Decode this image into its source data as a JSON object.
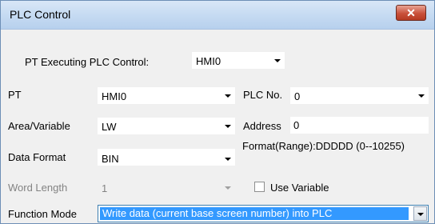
{
  "window": {
    "title": "PLC Control",
    "close_glyph": "✕"
  },
  "form": {
    "pt_exec": {
      "label": "PT Executing PLC Control:",
      "value": "HMI0"
    },
    "pt": {
      "label": "PT",
      "value": "HMI0"
    },
    "plc_no": {
      "label": "PLC No.",
      "value": "0"
    },
    "area": {
      "label": "Area/Variable",
      "value": "LW"
    },
    "address": {
      "label": "Address",
      "value": "0"
    },
    "data_format": {
      "label": "Data Format",
      "value": "BIN"
    },
    "format_range": {
      "label": "Format(Range):DDDDD (0--10255)"
    },
    "word_length": {
      "label": "Word Length",
      "value": "1"
    },
    "use_variable": {
      "label": "Use Variable",
      "checked": false
    },
    "function_mode": {
      "label": "Function Mode",
      "value": "Write data (current base screen number) into PLC"
    }
  },
  "colors": {
    "selection": "#3399ff",
    "titlebar": "#c6dbf2",
    "close": "#c9503a"
  }
}
